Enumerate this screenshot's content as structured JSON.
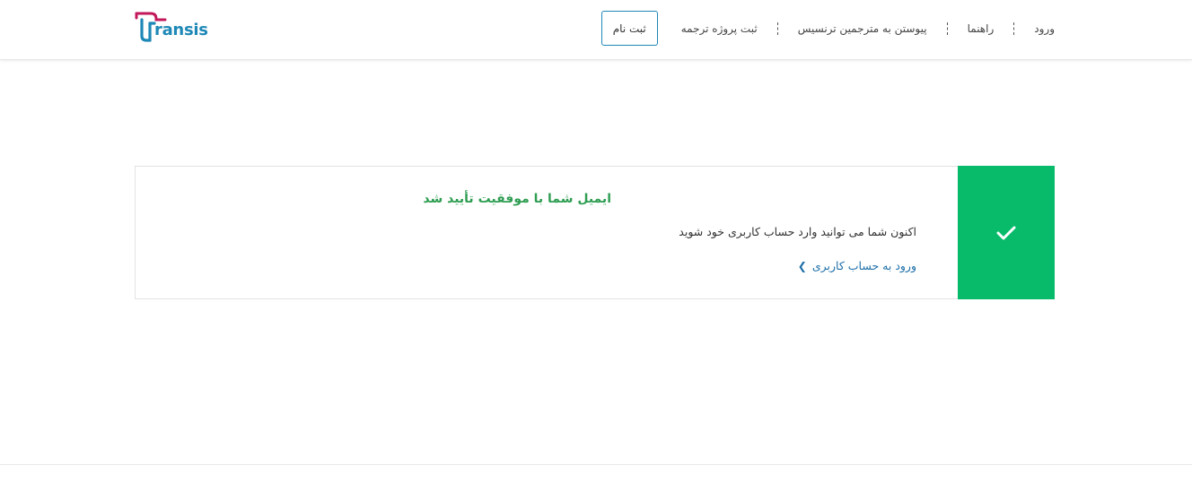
{
  "brand": {
    "logo_text": "ransis",
    "primary_color": "#1e88b6",
    "accent_color": "#c2185b"
  },
  "nav": {
    "register_label": "ثبت نام",
    "links": [
      "ورود",
      "راهنما",
      "پیوستن به مترجمین ترنسیس",
      "ثبت پروژه ترجمه"
    ]
  },
  "card": {
    "icon": "checkmark-icon",
    "icon_bg": "#08bb6b",
    "title": "ایمیل شما با موفقیت تأیید شد",
    "description": "اکنون شما می توانید وارد حساب کاربری خود شوید",
    "link_label": "ورود به حساب کاربری",
    "link_icon": "chevron-left-icon",
    "title_color": "#2e9d52"
  }
}
